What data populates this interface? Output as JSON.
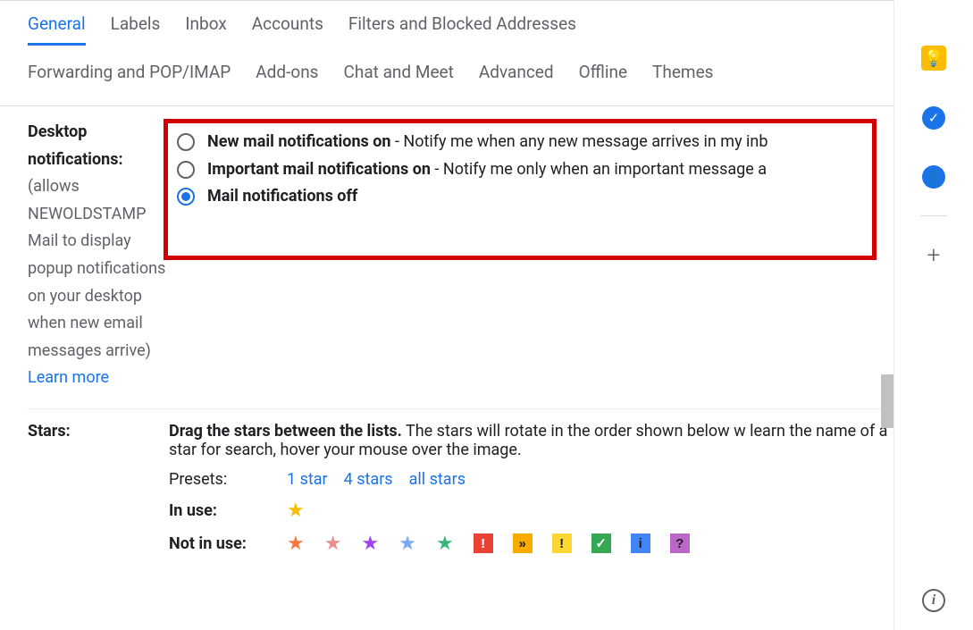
{
  "tabs": {
    "row1": [
      "General",
      "Labels",
      "Inbox",
      "Accounts",
      "Filters and Blocked Addresses"
    ],
    "row2": [
      "Forwarding and POP/IMAP",
      "Add-ons",
      "Chat and Meet",
      "Advanced",
      "Offline",
      "Themes"
    ],
    "active": "General"
  },
  "notifications": {
    "label_bold": "Desktop notifications:",
    "label_help": "(allows NEWOLDSTAMP Mail to display popup notifications on your desktop when new email messages arrive)",
    "learn_more": "Learn more",
    "options": [
      {
        "bold": "New mail notifications on",
        "rest": " - Notify me when any new message arrives in my inb",
        "selected": false
      },
      {
        "bold": "Important mail notifications on",
        "rest": " - Notify me only when an important message a",
        "selected": false
      },
      {
        "bold": "Mail notifications off",
        "rest": "",
        "selected": true
      }
    ]
  },
  "stars": {
    "label": "Stars:",
    "desc_bold": "Drag the stars between the lists.",
    "desc_rest": "  The stars will rotate in the order shown below w learn the name of a star for search, hover your mouse over the image.",
    "presets_label": "Presets:",
    "presets": [
      "1 star",
      "4 stars",
      "all stars"
    ],
    "in_use_label": "In use:",
    "not_in_use_label": "Not in use:",
    "in_use": [
      {
        "type": "star",
        "color": "#fbbc04"
      }
    ],
    "not_in_use": [
      {
        "type": "star",
        "color": "#f5793a"
      },
      {
        "type": "star",
        "color": "#ea8f8f"
      },
      {
        "type": "star",
        "color": "#a142f4"
      },
      {
        "type": "star",
        "color": "#78a9f7"
      },
      {
        "type": "star",
        "color": "#3ab67a"
      },
      {
        "type": "sq",
        "bg": "#ea4335",
        "fg": "#fff",
        "char": "!"
      },
      {
        "type": "sq",
        "bg": "#f9ab00",
        "fg": "#202124",
        "char": "»"
      },
      {
        "type": "sq",
        "bg": "#fdd835",
        "fg": "#202124",
        "char": "!"
      },
      {
        "type": "sq",
        "bg": "#34a853",
        "fg": "#fff",
        "char": "✓"
      },
      {
        "type": "sq",
        "bg": "#4285f4",
        "fg": "#202124",
        "char": "i"
      },
      {
        "type": "sq",
        "bg": "#ba68c8",
        "fg": "#202124",
        "char": "?"
      }
    ]
  },
  "sidepanel": {
    "keep": "💡",
    "tasks": "✓",
    "contacts": "👤",
    "plus": "+",
    "info": "i"
  }
}
